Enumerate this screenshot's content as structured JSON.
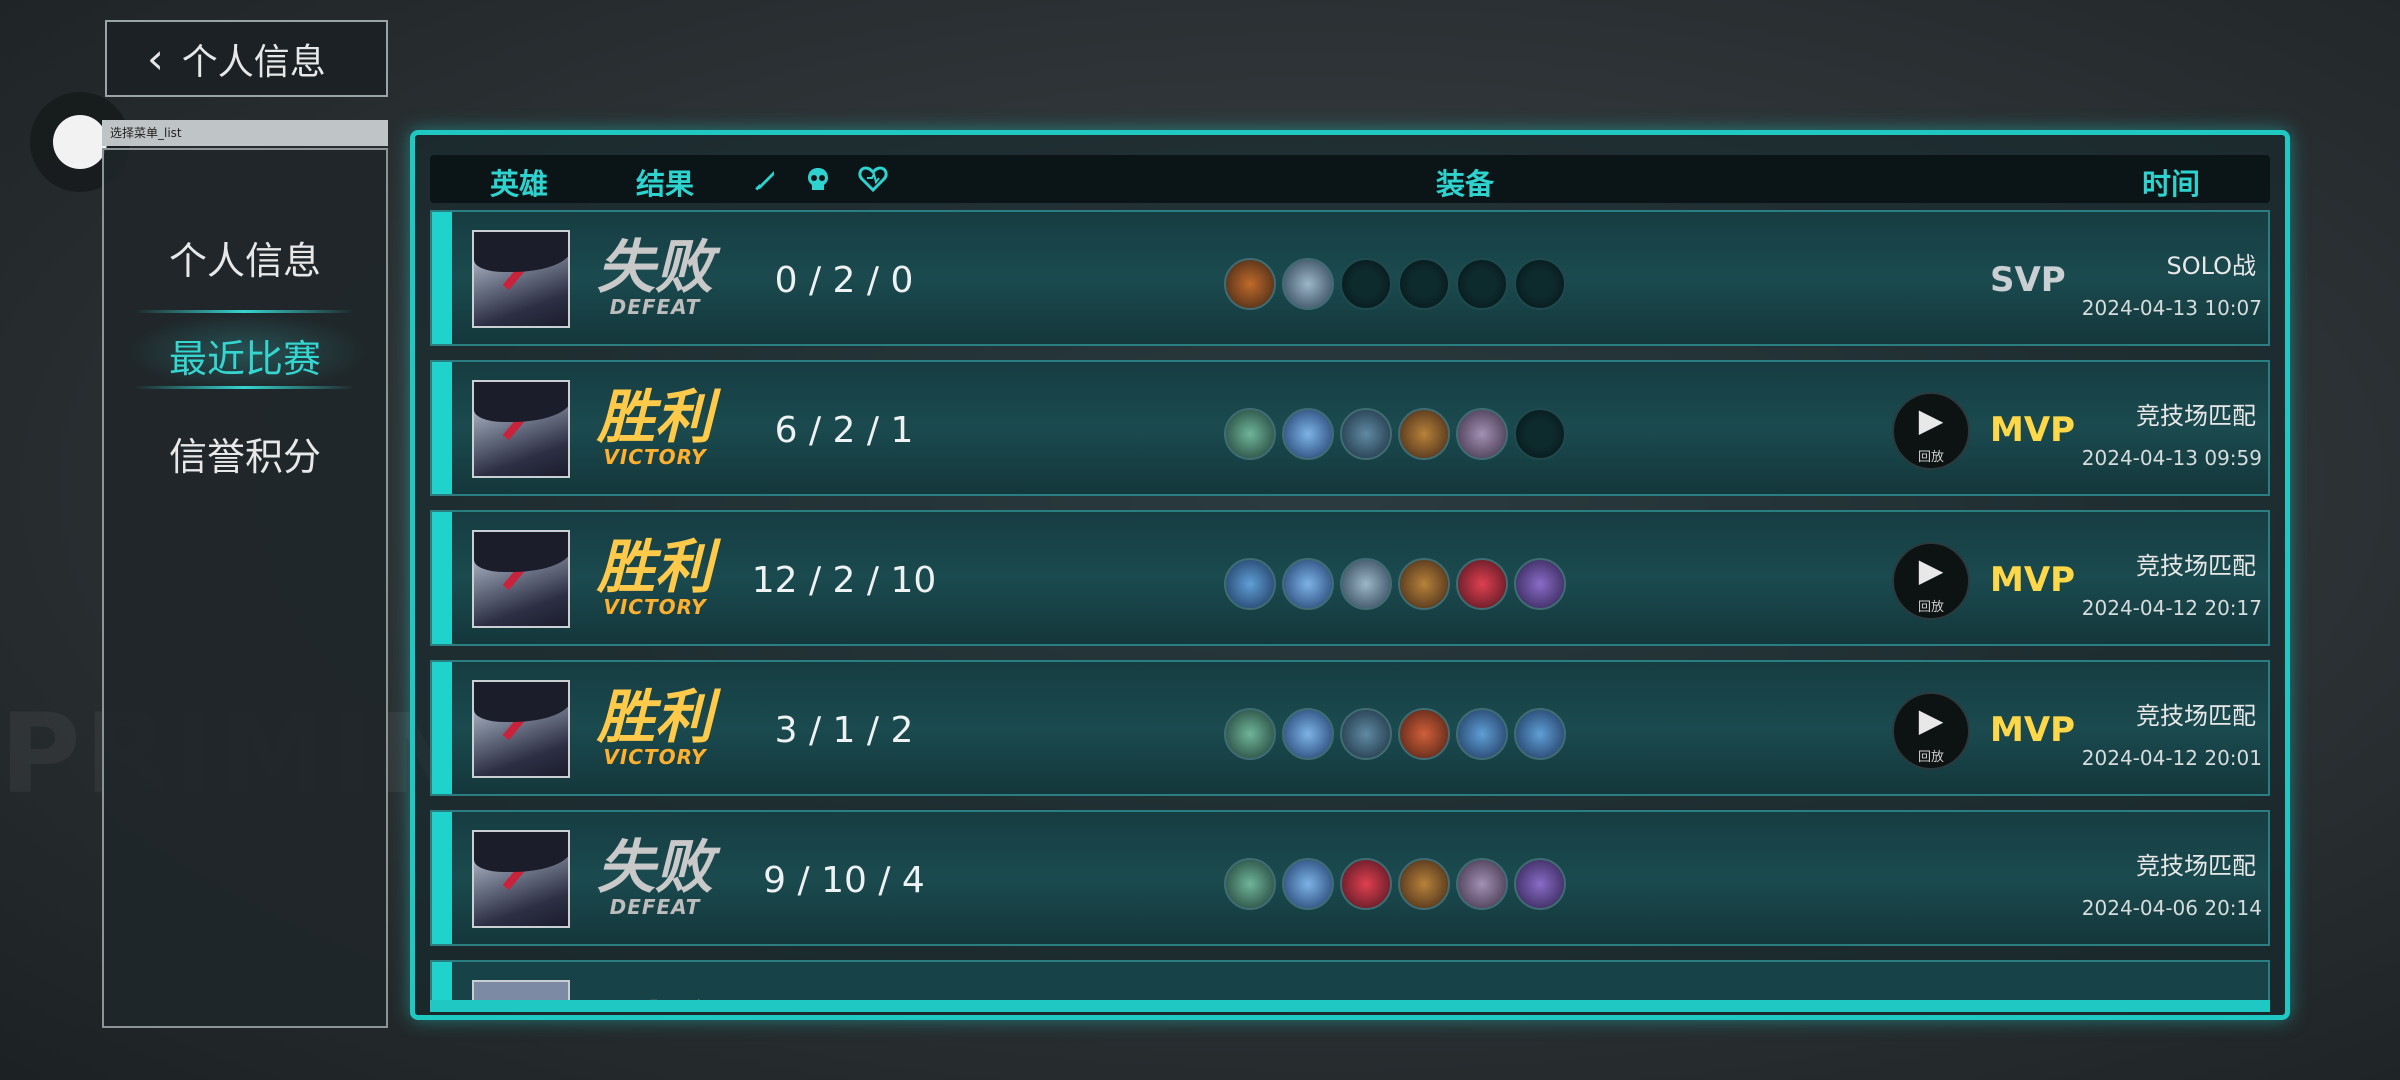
{
  "back_button": {
    "label": "个人信息"
  },
  "sidebar": {
    "tag": "选择菜单_list",
    "items": [
      {
        "label": "个人信息"
      },
      {
        "label": "最近比赛"
      },
      {
        "label": "信誉积分"
      }
    ]
  },
  "header": {
    "hero": "英雄",
    "result": "结果",
    "equipment": "装备",
    "time": "时间"
  },
  "matches": [
    {
      "result_cn": "失败",
      "result_en": "DEFEAT",
      "kda": "0 / 2 / 0",
      "rank": "SVP",
      "mode": "SOLO战",
      "time": "2024-04-13 10:07",
      "replay_label": ""
    },
    {
      "result_cn": "胜利",
      "result_en": "VICTORY",
      "kda": "6 / 2 / 1",
      "rank": "MVP",
      "mode": "竞技场匹配",
      "time": "2024-04-13 09:59",
      "replay_label": "回放"
    },
    {
      "result_cn": "胜利",
      "result_en": "VICTORY",
      "kda": "12 / 2 / 10",
      "rank": "MVP",
      "mode": "竞技场匹配",
      "time": "2024-04-12 20:17",
      "replay_label": "回放"
    },
    {
      "result_cn": "胜利",
      "result_en": "VICTORY",
      "kda": "3 / 1 / 2",
      "rank": "MVP",
      "mode": "竞技场匹配",
      "time": "2024-04-12 20:01",
      "replay_label": "回放"
    },
    {
      "result_cn": "失败",
      "result_en": "DEFEAT",
      "kda": "9 / 10 / 4",
      "rank": "",
      "mode": "竞技场匹配",
      "time": "2024-04-06 20:14",
      "replay_label": ""
    }
  ],
  "partial_row": {
    "result_cn": "胜利"
  },
  "colors": {
    "accent": "#1fc8c3",
    "victory": "#ffc94a",
    "defeat": "#c9c9c9",
    "mvp": "#ffd84a"
  }
}
